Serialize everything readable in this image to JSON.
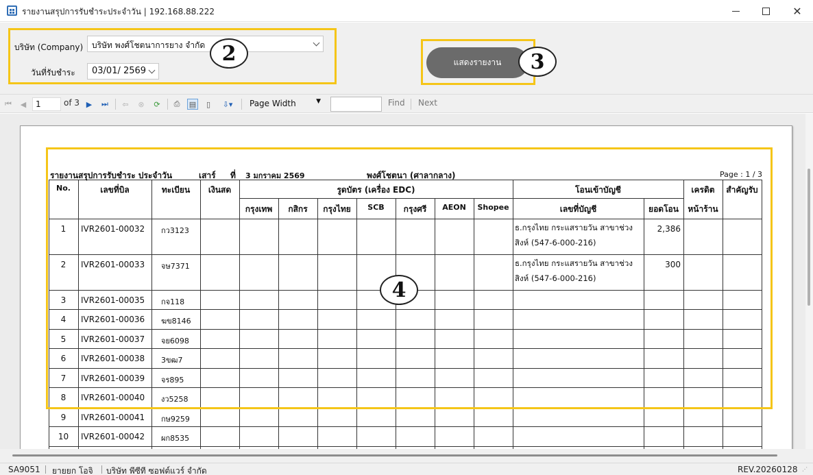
{
  "window": {
    "title": "รายงานสรุปการรับชำระประจำวัน | 192.168.88.222"
  },
  "filters": {
    "company_label": "บริษัท (Company)",
    "company_value": "บริษัท พงศ์โชตนาการยาง จำกัด",
    "date_label": "วันที่รับชำระ",
    "date_value": "03/01/  2569",
    "show_button": "แสดงรายงาน"
  },
  "markers": {
    "m2": "2",
    "m3": "3",
    "m4": "4"
  },
  "toolbar": {
    "page_input": "1",
    "of_label": "of 3",
    "zoom": "Page Width",
    "find": "Find",
    "next": "Next"
  },
  "report": {
    "title": "รายงานสรุปการรับชำระ ประจำวัน",
    "day": "เสาร์",
    "thi": "ที่",
    "date": "3 มกราคม 2569",
    "company": "พงศ์โชตนา (ศาลากลาง)",
    "page": "Page : 1 / 3",
    "headers": {
      "no": "No.",
      "bill": "เลขที่บิล",
      "plate": "ทะเบียน",
      "cash": "เงินสด",
      "card_group": "รูดบัตร (เครื่อง EDC)",
      "cards": [
        "กรุงเทพ",
        "กสิกร",
        "กรุงไทย",
        "SCB",
        "กรุงศรี",
        "AEON",
        "Shopee"
      ],
      "transfer_group": "โอนเข้าบัญชี",
      "account": "เลขที่บัญชี",
      "transfer_amount": "ยอดโอน",
      "credit_line1": "เครดิต",
      "credit_line2": "หน้าร้าน",
      "receipt": "สำคัญรับ"
    },
    "rows": [
      {
        "no": "1",
        "bill": "IVR2601-00032",
        "plate": "กว3123",
        "account_line1": "ธ.กรุงไทย กระแสรายวัน สาขาช่วง",
        "account_line2": "สิงห์ (547-6-000-216)",
        "amount": "2,386"
      },
      {
        "no": "2",
        "bill": "IVR2601-00033",
        "plate": "จษ7371",
        "account_line1": "ธ.กรุงไทย กระแสรายวัน สาขาช่วง",
        "account_line2": "สิงห์ (547-6-000-216)",
        "amount": "300"
      },
      {
        "no": "3",
        "bill": "IVR2601-00035",
        "plate": "กจ118"
      },
      {
        "no": "4",
        "bill": "IVR2601-00036",
        "plate": "ฆข8146"
      },
      {
        "no": "5",
        "bill": "IVR2601-00037",
        "plate": "จย6098"
      },
      {
        "no": "6",
        "bill": "IVR2601-00038",
        "plate": "3ขฒ7"
      },
      {
        "no": "7",
        "bill": "IVR2601-00039",
        "plate": "จร895"
      },
      {
        "no": "8",
        "bill": "IVR2601-00040",
        "plate": "งว5258"
      },
      {
        "no": "9",
        "bill": "IVR2601-00041",
        "plate": "กษ9259"
      },
      {
        "no": "10",
        "bill": "IVR2601-00042",
        "plate": "ผก8535"
      }
    ]
  },
  "status": {
    "code": "SA9051",
    "user": "ยายยก  โอจิ",
    "company": "บริษัท พีซีที ซอฟต์แวร์ จำกัด",
    "rev": "REV.20260128"
  }
}
